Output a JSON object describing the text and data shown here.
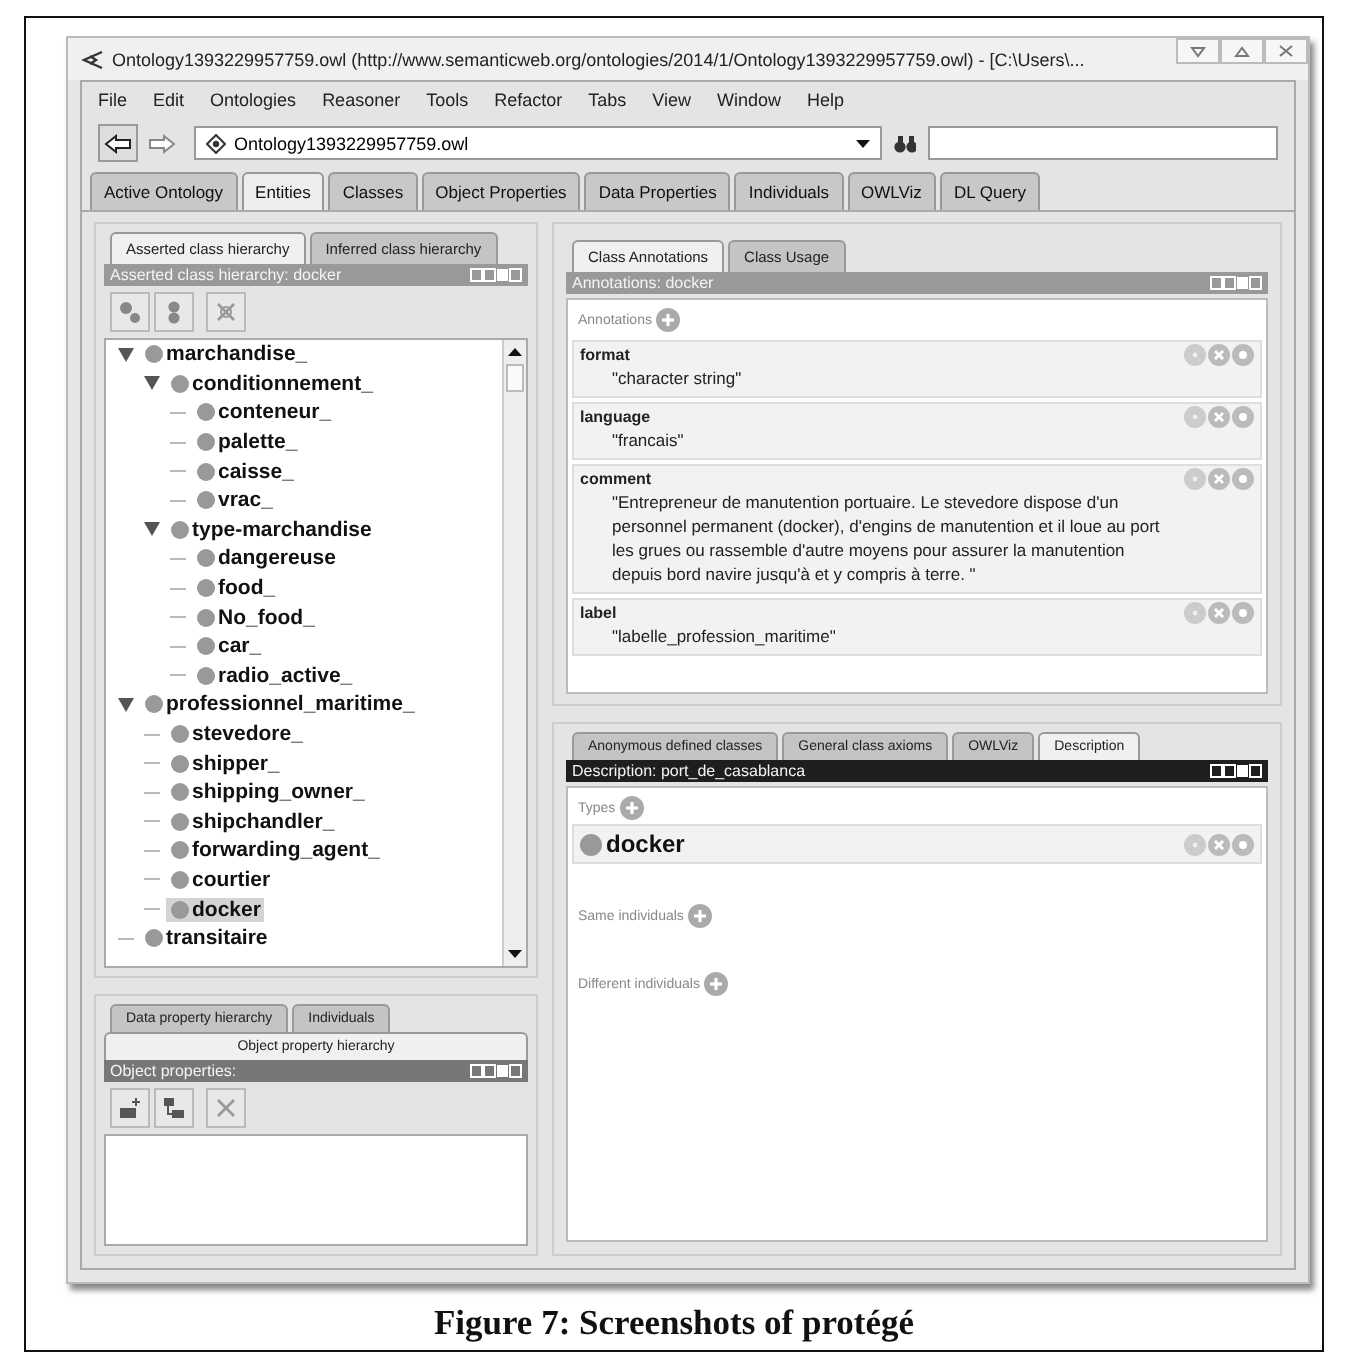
{
  "window": {
    "title": "Ontology1393229957759.owl (http://www.semanticweb.org/ontologies/2014/1/Ontology1393229957759.owl) - [C:\\Users\\..."
  },
  "menu": [
    "File",
    "Edit",
    "Ontologies",
    "Reasoner",
    "Tools",
    "Refactor",
    "Tabs",
    "View",
    "Window",
    "Help"
  ],
  "toolbar": {
    "ontology": "Ontology1393229957759.owl"
  },
  "main_tabs": [
    {
      "label": "Active Ontology",
      "selected": false
    },
    {
      "label": "Entities",
      "selected": true
    },
    {
      "label": "Classes",
      "selected": false
    },
    {
      "label": "Object Properties",
      "selected": false
    },
    {
      "label": "Data Properties",
      "selected": false
    },
    {
      "label": "Individuals",
      "selected": false
    },
    {
      "label": "OWLViz",
      "selected": false
    },
    {
      "label": "DL Query",
      "selected": false
    }
  ],
  "class_hierarchy": {
    "tabs": [
      {
        "label": "Asserted class hierarchy",
        "selected": true
      },
      {
        "label": "Inferred class hierarchy",
        "selected": false
      }
    ],
    "header": {
      "text": "Asserted class hierarchy: docker",
      "active": false
    },
    "tree": [
      {
        "label": "marchandise_",
        "expanded": true,
        "selected": false,
        "children": [
          {
            "label": "conditionnement_",
            "expanded": true,
            "selected": false,
            "children": [
              {
                "label": "conteneur_",
                "selected": false
              },
              {
                "label": "palette_",
                "selected": false
              },
              {
                "label": "caisse_",
                "selected": false
              },
              {
                "label": "vrac_",
                "selected": false
              }
            ]
          },
          {
            "label": "type-marchandise",
            "expanded": true,
            "selected": false,
            "children": [
              {
                "label": "dangereuse",
                "selected": false
              },
              {
                "label": "food_",
                "selected": false
              },
              {
                "label": "No_food_",
                "selected": false
              },
              {
                "label": "car_",
                "selected": false
              },
              {
                "label": "radio_active_",
                "selected": false
              }
            ]
          }
        ]
      },
      {
        "label": "professionnel_maritime_",
        "expanded": true,
        "selected": false,
        "children": [
          {
            "label": "stevedore_",
            "selected": false
          },
          {
            "label": "shipper_",
            "selected": false
          },
          {
            "label": "shipping_owner_",
            "selected": false
          },
          {
            "label": "shipchandler_",
            "selected": false
          },
          {
            "label": "forwarding_agent_",
            "selected": false
          },
          {
            "label": "courtier",
            "selected": false
          },
          {
            "label": "docker",
            "selected": true
          }
        ]
      },
      {
        "label": "transitaire",
        "selected": false
      }
    ]
  },
  "property_panel": {
    "tabs": [
      {
        "label": "Data property hierarchy",
        "selected": false
      },
      {
        "label": "Individuals",
        "selected": false
      },
      {
        "label": "Object property hierarchy",
        "selected": true
      }
    ],
    "header": {
      "text": "Object properties:",
      "active": false
    }
  },
  "annotations_panel": {
    "tabs": [
      {
        "label": "Class Annotations",
        "selected": true
      },
      {
        "label": "Class Usage",
        "selected": false
      }
    ],
    "header": {
      "text": "Annotations: docker",
      "active": false
    },
    "section": "Annotations",
    "items": [
      {
        "property": "format",
        "value": "\"character string\""
      },
      {
        "property": "language",
        "value": "\"francais\""
      },
      {
        "property": "comment",
        "value": "\"Entrepreneur de manutention portuaire. Le stevedore dispose d'un personnel permanent (docker), d'engins de manutention et il loue au port les grues ou rassemble d'autre moyens pour assurer la manutention depuis bord navire jusqu'à et y compris à terre. \""
      },
      {
        "property": "label",
        "value": "\"labelle_profession_maritime\""
      }
    ]
  },
  "description_panel": {
    "tabs": [
      {
        "label": "Anonymous defined classes",
        "selected": false
      },
      {
        "label": "General class axioms",
        "selected": false
      },
      {
        "label": "OWLViz",
        "selected": false
      },
      {
        "label": "Description",
        "selected": true
      }
    ],
    "header": {
      "text": "Description: port_de_casablanca",
      "active": true
    },
    "types_label": "Types",
    "types": [
      "docker"
    ],
    "same_label": "Same individuals",
    "different_label": "Different individuals"
  },
  "caption": "Figure 7: Screenshots of protégé"
}
